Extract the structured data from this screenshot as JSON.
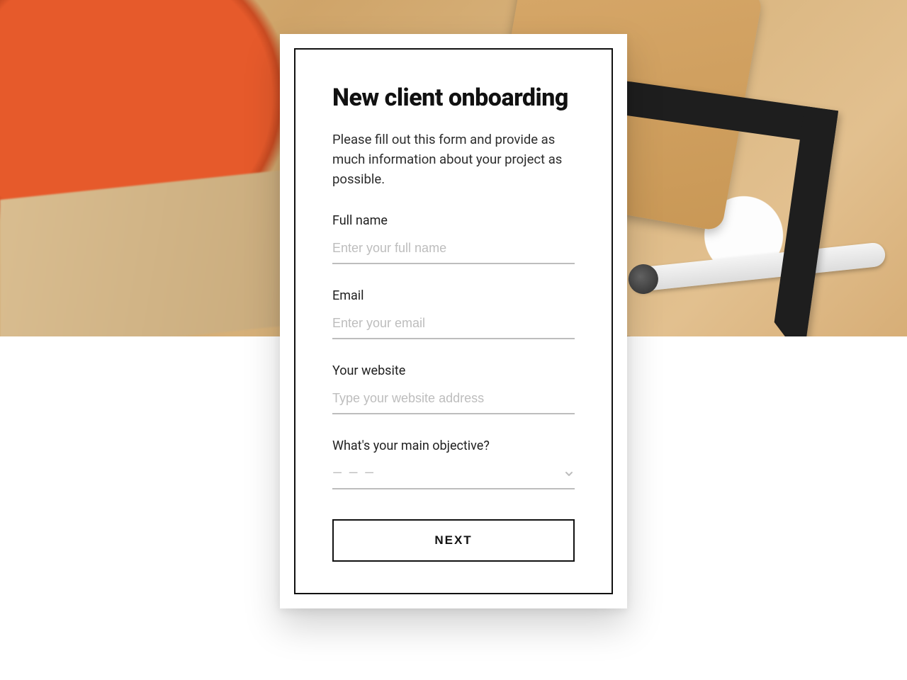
{
  "form": {
    "title": "New client onboarding",
    "description": "Please fill out this form and provide as much information about your project as possible.",
    "fields": {
      "full_name": {
        "label": "Full name",
        "placeholder": "Enter your full name",
        "value": ""
      },
      "email": {
        "label": "Email",
        "placeholder": "Enter your email",
        "value": ""
      },
      "website": {
        "label": "Your website",
        "placeholder": "Type your website address",
        "value": ""
      },
      "objective": {
        "label": "What's your main objective?",
        "placeholder": "— — —",
        "value": ""
      }
    },
    "submit_label": "NEXT"
  }
}
